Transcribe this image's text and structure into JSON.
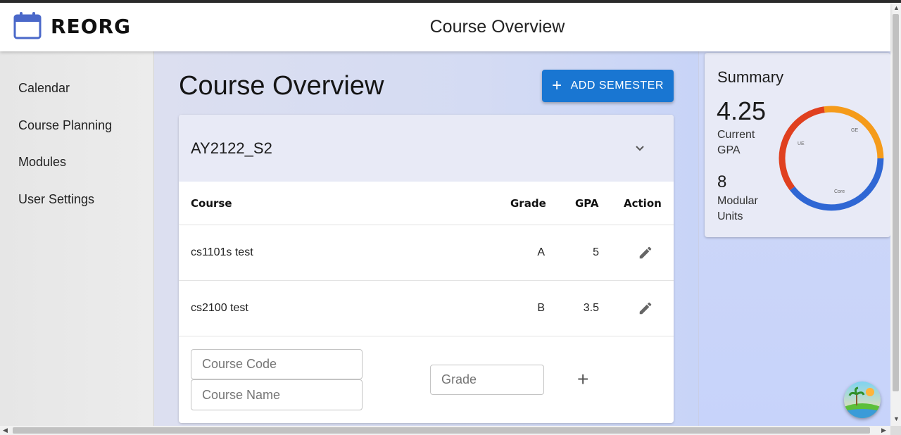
{
  "app": {
    "brand": "REORG",
    "title": "Course Overview"
  },
  "sidebar": {
    "items": [
      {
        "label": "Calendar"
      },
      {
        "label": "Course Planning"
      },
      {
        "label": "Modules"
      },
      {
        "label": "User Settings"
      }
    ]
  },
  "main": {
    "heading": "Course Overview",
    "add_semester_label": "ADD SEMESTER",
    "semester": {
      "name": "AY2122_S2",
      "columns": {
        "course": "Course",
        "grade": "Grade",
        "gpa": "GPA",
        "action": "Action"
      },
      "rows": [
        {
          "course": "cs1101s test",
          "grade": "A",
          "gpa": "5"
        },
        {
          "course": "cs2100 test",
          "grade": "B",
          "gpa": "3.5"
        }
      ],
      "new_row": {
        "course_code_placeholder": "Course Code",
        "course_name_placeholder": "Course Name",
        "grade_placeholder": "Grade"
      }
    }
  },
  "summary": {
    "title": "Summary",
    "gpa_value": "4.25",
    "gpa_label": "Current GPA",
    "units_value": "8",
    "units_label": "Modular Units",
    "chart_segments": [
      {
        "label": "GE",
        "color": "#f59b1a"
      },
      {
        "label": "Core",
        "color": "#2f67d4"
      },
      {
        "label": "UE",
        "color": "#e0401f"
      }
    ]
  },
  "colors": {
    "accent": "#1976d2",
    "header_bg": "#e8eaf6"
  }
}
